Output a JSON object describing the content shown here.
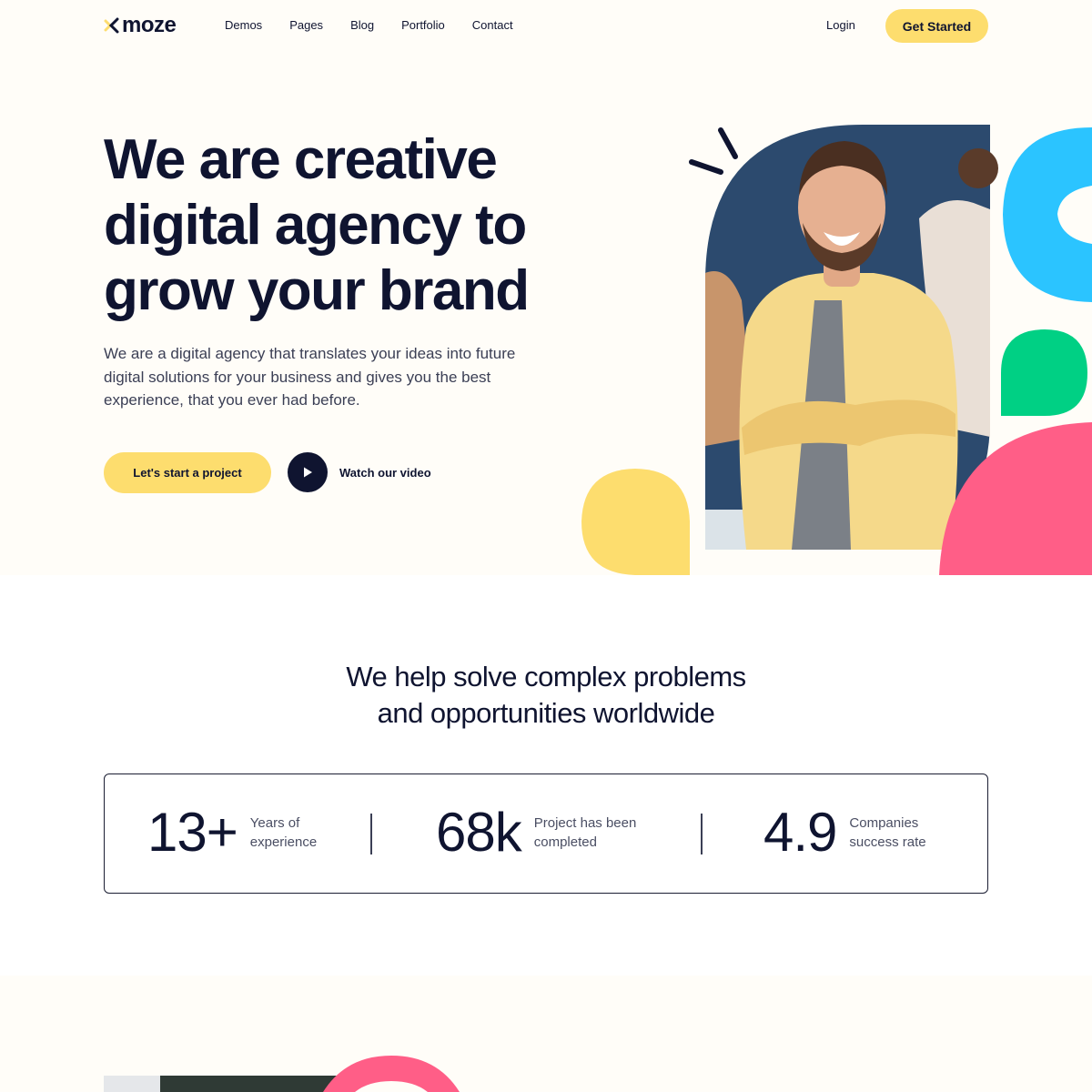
{
  "header": {
    "logo_text": "moze",
    "nav": [
      "Demos",
      "Pages",
      "Blog",
      "Portfolio",
      "Contact"
    ],
    "login_label": "Login",
    "cta_label": "Get Started"
  },
  "hero": {
    "title_lines": [
      "We are creative",
      "digital agency to",
      "grow your brand"
    ],
    "description": "We are a digital agency that translates your ideas into future digital solutions for your business and gives you the best experience, that you ever had before.",
    "primary_cta": "Let's start a project",
    "video_label": "Watch our video"
  },
  "section2": {
    "title_lines": [
      "We help solve complex problems",
      "and opportunities worldwide"
    ],
    "stats": [
      {
        "value": "13+",
        "label": "Years of experience"
      },
      {
        "value": "68k",
        "label": "Project has been completed"
      },
      {
        "value": "4.9",
        "label": "Companies success rate"
      }
    ]
  },
  "colors": {
    "yellow": "#fddd6e",
    "navy": "#0f1430",
    "blue": "#2bc4ff",
    "green": "#00d084",
    "pink": "#ff5e87",
    "background": "#fffdf8"
  }
}
